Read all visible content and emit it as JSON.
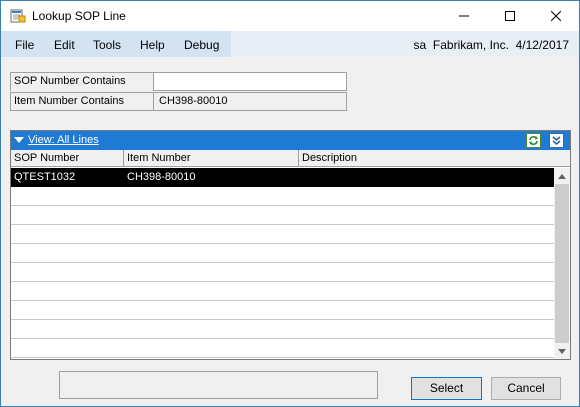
{
  "window": {
    "title": "Lookup SOP Line"
  },
  "menubar": {
    "items": [
      "File",
      "Edit",
      "Tools",
      "Help",
      "Debug"
    ],
    "user": "sa",
    "company": "Fabrikam, Inc.",
    "date": "4/12/2017"
  },
  "filters": {
    "sop_label": "SOP Number Contains",
    "sop_value": "",
    "item_label": "Item Number Contains",
    "item_value": "CH398-80010"
  },
  "grid": {
    "view_label": "View: All Lines",
    "columns": [
      "SOP Number",
      "Item Number",
      "Description"
    ],
    "rows": [
      {
        "sop": "QTEST1032",
        "item": "CH398-80010",
        "description": "",
        "selected": true
      }
    ],
    "empty_rows": 9
  },
  "buttons": {
    "select": "Select",
    "cancel": "Cancel"
  },
  "colors": {
    "header_blue": "#1f7ad4",
    "menubar": "#d4e3f2",
    "selected_row": "#000000"
  },
  "icons": {
    "app": "lookup-window-icon",
    "refresh": "refresh-icon",
    "expand": "expand-icon"
  }
}
